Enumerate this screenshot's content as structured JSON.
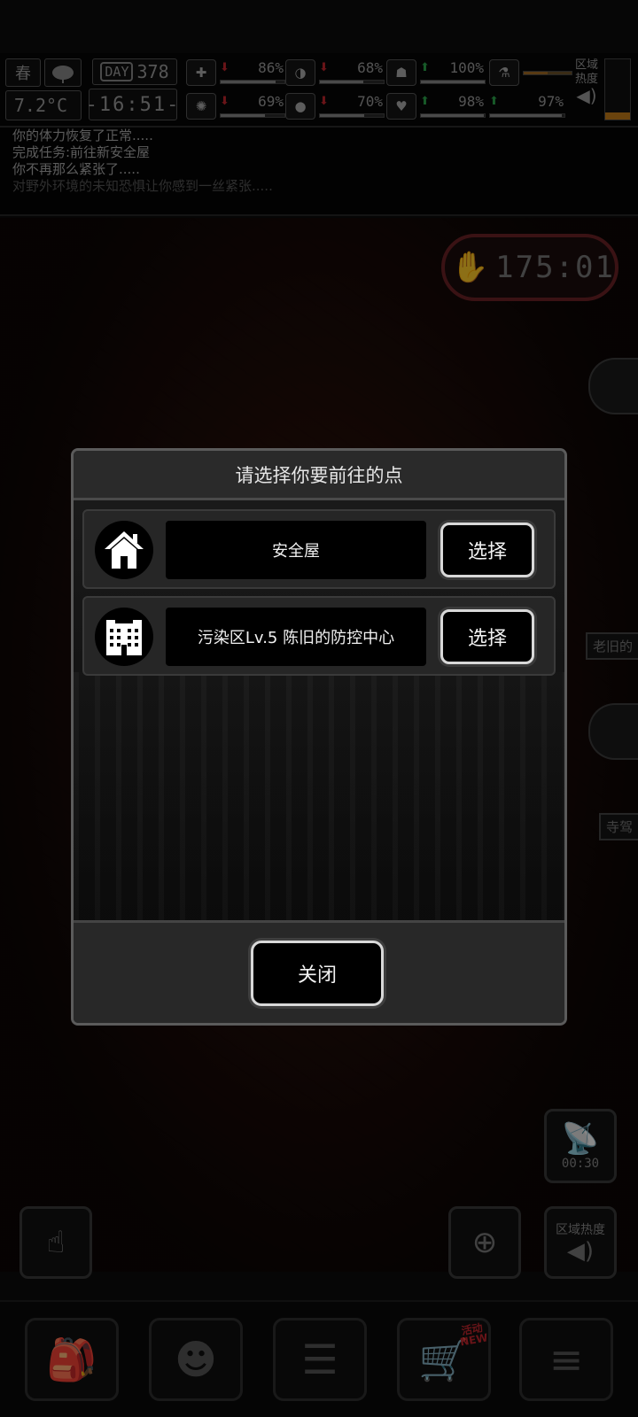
{
  "hud": {
    "season": "春",
    "temperature": "7.2°C",
    "day_label": "DAY",
    "day_number": "378",
    "clock": "-16:51-",
    "stats": [
      {
        "icon": "first-aid-icon",
        "symbol": "✚",
        "arrow": "down",
        "value": "86%",
        "level": 0.86
      },
      {
        "icon": "stomach-icon",
        "symbol": "◑",
        "arrow": "down",
        "value": "68%",
        "level": 0.68
      },
      {
        "icon": "mask-icon",
        "symbol": "☗",
        "arrow": "up",
        "value": "100%",
        "level": 1.0
      },
      {
        "icon": "flask-icon",
        "symbol": "⚗",
        "arrow": "none",
        "value": "",
        "level": 0.5
      },
      {
        "icon": "brain-icon",
        "symbol": "✺",
        "arrow": "down",
        "value": "69%",
        "level": 0.69
      },
      {
        "icon": "water-drop-icon",
        "symbol": "💧",
        "arrow": "down",
        "value": "70%",
        "level": 0.7
      },
      {
        "icon": "heart-icon",
        "symbol": "♥",
        "arrow": "up",
        "value": "98%",
        "level": 0.98
      },
      {
        "icon": "energy-icon",
        "symbol": "⚡",
        "arrow": "up",
        "value": "97%",
        "level": 0.97
      }
    ],
    "zone_heat_label": "区域热度"
  },
  "log": {
    "lines": [
      "你的体力恢复了正常.....",
      "完成任务:前往新安全屋",
      "你不再那么紧张了.....",
      "对野外环境的未知恐惧让你感到一丝紧张....."
    ]
  },
  "map": {
    "timer": "175:01",
    "side_label_1": "老旧的",
    "side_label_2": "寺驾",
    "satellite_time": "00:30",
    "zone_heat_label": "区域热度"
  },
  "modal": {
    "title": "请选择你要前往的点",
    "destinations": [
      {
        "name": "安全屋",
        "icon": "house-icon",
        "button": "选择"
      },
      {
        "name": "污染区Lv.5 陈旧的防控中心",
        "icon": "building-icon",
        "button": "选择"
      }
    ],
    "close_label": "关闭"
  },
  "toolbar": {
    "items": [
      {
        "name": "backpack-icon"
      },
      {
        "name": "skills-brain-icon"
      },
      {
        "name": "quest-notebook-icon"
      },
      {
        "name": "shop-cart-icon",
        "badge_top": "活动",
        "badge_bottom": "NEW"
      },
      {
        "name": "menu-icon"
      }
    ]
  },
  "colors": {
    "stat_up": "#2aa34a",
    "stat_down": "#c0262c",
    "timer_border": "#6b2226"
  }
}
